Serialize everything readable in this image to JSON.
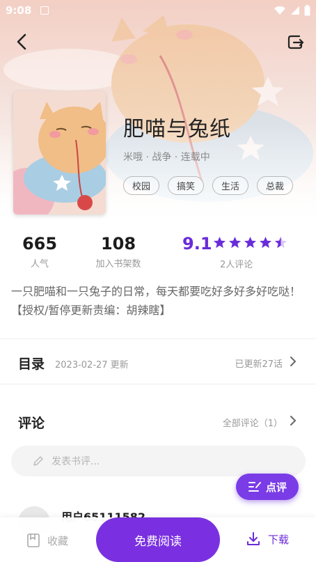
{
  "status_bar": {
    "time": "9:08"
  },
  "book": {
    "title": "肥喵与兔纸",
    "meta": "米哦 · 战争 · 连载中",
    "tags": [
      "校园",
      "搞笑",
      "生活",
      "总裁"
    ]
  },
  "stats": {
    "popularity": {
      "value": "665",
      "label": "人气"
    },
    "shelf": {
      "value": "108",
      "label": "加入书架数"
    },
    "rating": {
      "value": "9.1",
      "label": "2人评论",
      "stars_out_of_5": 4.5
    }
  },
  "synopsis": "一只肥喵和一只兔子的日常，每天都要吃好多好多好吃哒！【授权/暂停更新责编：胡辣瞎】",
  "toc": {
    "title": "目录",
    "date": "2023-02-27 更新",
    "count": "已更新27话"
  },
  "comments": {
    "title": "评论",
    "all_link": "全部评论（1）",
    "input_placeholder": "发表书评...",
    "review_button": "点评",
    "first_user": "用户65111582"
  },
  "bottom_bar": {
    "favorite": "收藏",
    "read": "免费阅读",
    "download": "下载"
  },
  "colors": {
    "accent": "#7a30e0",
    "rating": "#6a2bd9"
  }
}
